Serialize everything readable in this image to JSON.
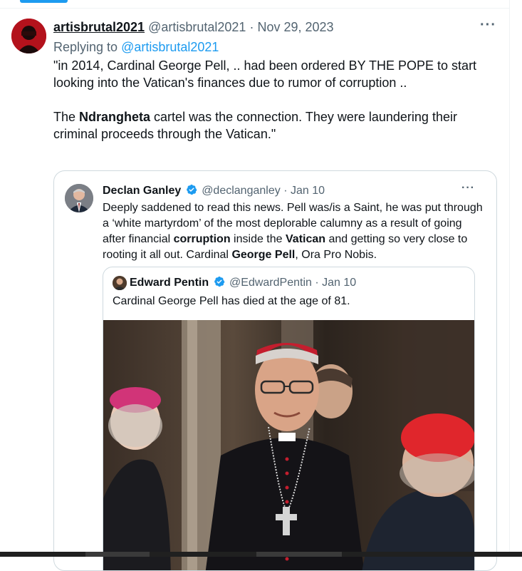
{
  "tweet": {
    "display_name": "artisbrutal2021",
    "handle": "@artisbrutal2021",
    "separator": "·",
    "date": "Nov 29, 2023",
    "replying_prefix": "Replying to",
    "replying_handle": "@artisbrutal2021",
    "more_label": "···",
    "text": {
      "p1": "\"in 2014, Cardinal George Pell, .. had been ordered BY THE POPE to start looking into the Vatican's finances due to rumor of corruption ..",
      "p2_before": "The ",
      "p2_bold": "Ndrangheta",
      "p2_after": " cartel was the connection. They were laundering their criminal proceeds through the Vatican.\""
    }
  },
  "quote1": {
    "display_name": "Declan Ganley",
    "handle": "@declanganley",
    "separator": "·",
    "date": "Jan 10",
    "more_label": "···",
    "text": {
      "a": "Deeply saddened to read this news. Pell was/is a Saint, he was put through a ‘white martyrdom’ of the most deplorable calumny as a result of going after financial ",
      "b": "corruption",
      "c": " inside the ",
      "d": "Vatican",
      "e": " and getting so very close to rooting it all out. Cardinal ",
      "f": "George Pell",
      "g": ", Ora Pro Nobis."
    }
  },
  "quote2": {
    "display_name": "Edward Pentin",
    "handle": "@EdwardPentin",
    "separator": "·",
    "date": "Jan 10",
    "text": "Cardinal George Pell has died at the age of 81."
  },
  "colors": {
    "accent": "#1d9bf0",
    "secondary_text": "#536471",
    "border": "#cfd9de",
    "cardinal_red": "#c8102e"
  }
}
